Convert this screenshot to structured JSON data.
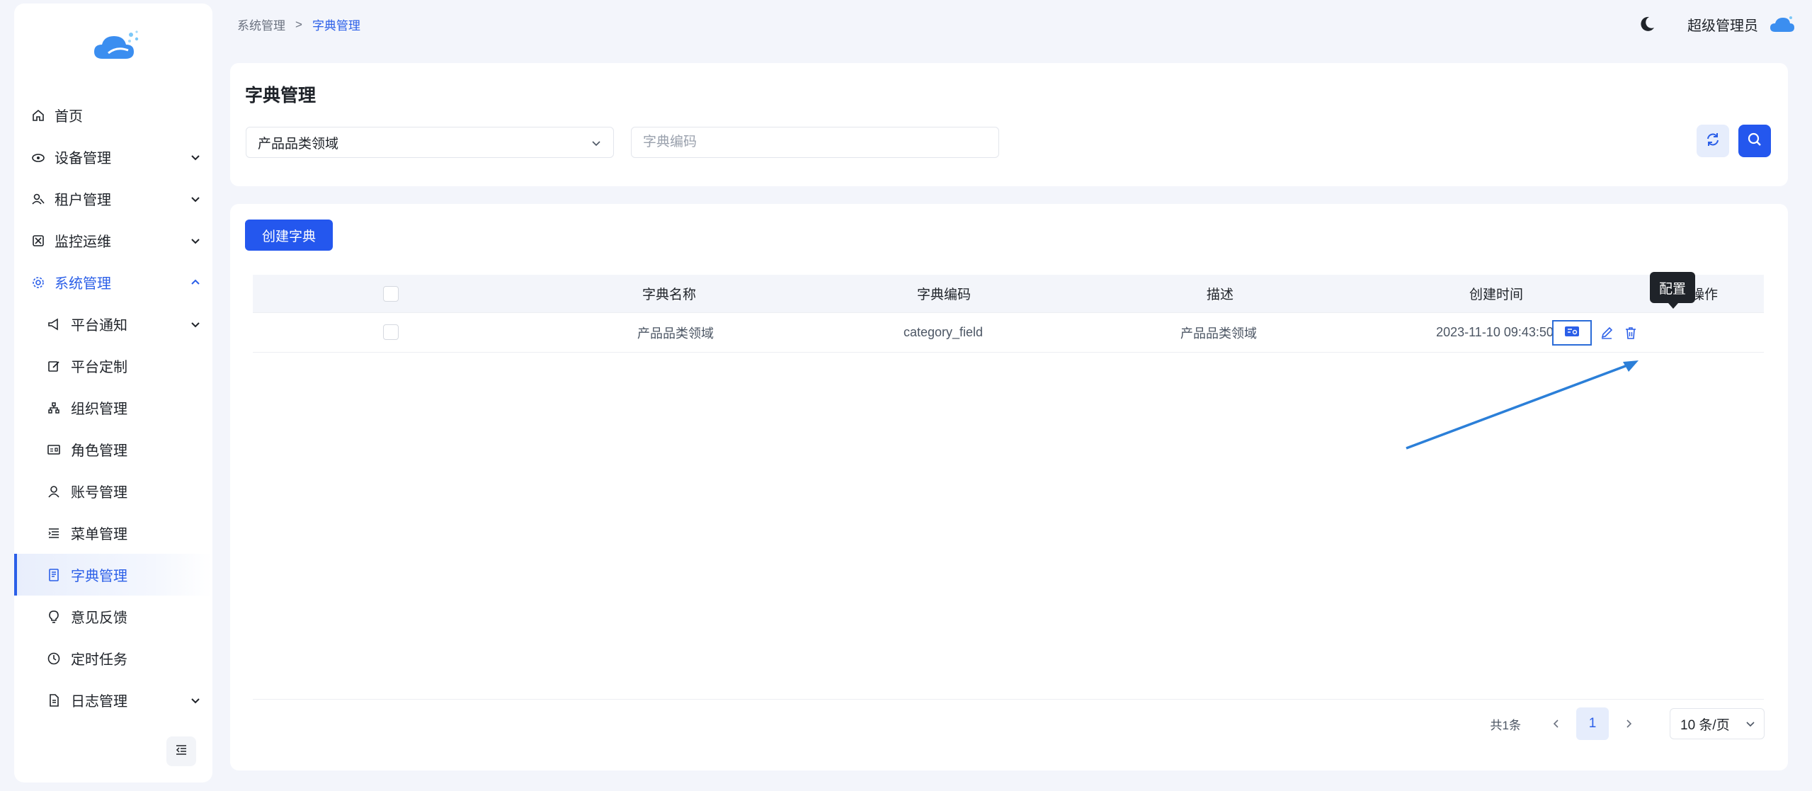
{
  "sidebar": {
    "items": [
      {
        "label": "首页",
        "icon": "home-icon"
      },
      {
        "label": "设备管理",
        "icon": "device-icon"
      },
      {
        "label": "租户管理",
        "icon": "users-icon"
      },
      {
        "label": "监控运维",
        "icon": "monitor-icon"
      },
      {
        "label": "系统管理",
        "icon": "gear-icon"
      },
      {
        "label": "平台通知",
        "icon": "megaphone-icon"
      },
      {
        "label": "平台定制",
        "icon": "edit-icon"
      },
      {
        "label": "组织管理",
        "icon": "org-icon"
      },
      {
        "label": "角色管理",
        "icon": "id-card-icon"
      },
      {
        "label": "账号管理",
        "icon": "user-icon"
      },
      {
        "label": "菜单管理",
        "icon": "menu-list-icon"
      },
      {
        "label": "字典管理",
        "icon": "dictionary-icon"
      },
      {
        "label": "意见反馈",
        "icon": "bulb-icon"
      },
      {
        "label": "定时任务",
        "icon": "clock-icon"
      },
      {
        "label": "日志管理",
        "icon": "document-icon"
      }
    ]
  },
  "breadcrumb": {
    "parent": "系统管理",
    "separator": ">",
    "current": "字典管理"
  },
  "header": {
    "user_name": "超级管理员"
  },
  "filter": {
    "title": "字典管理",
    "select_value": "产品品类领域",
    "code_placeholder": "字典编码"
  },
  "toolbar": {
    "create_label": "创建字典"
  },
  "table": {
    "columns": [
      "字典名称",
      "字典编码",
      "描述",
      "创建时间",
      "操作"
    ],
    "rows": [
      {
        "name": "产品品类领域",
        "code": "category_field",
        "desc": "产品品类领域",
        "created": "2023-11-10 09:43:50"
      }
    ],
    "tooltip": "配置"
  },
  "pagination": {
    "total": "共1条",
    "page": "1",
    "page_size": "10 条/页"
  },
  "colors": {
    "primary": "#2457ee",
    "annotation": "#2b7fd8"
  }
}
